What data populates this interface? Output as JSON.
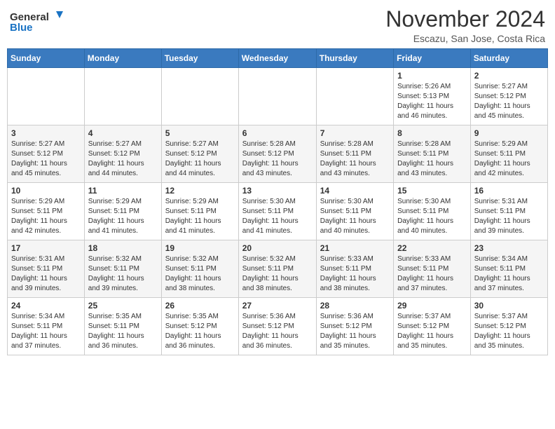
{
  "header": {
    "logo_line1": "General",
    "logo_line2": "Blue",
    "month": "November 2024",
    "location": "Escazu, San Jose, Costa Rica"
  },
  "days_of_week": [
    "Sunday",
    "Monday",
    "Tuesday",
    "Wednesday",
    "Thursday",
    "Friday",
    "Saturday"
  ],
  "weeks": [
    [
      {
        "day": "",
        "info": ""
      },
      {
        "day": "",
        "info": ""
      },
      {
        "day": "",
        "info": ""
      },
      {
        "day": "",
        "info": ""
      },
      {
        "day": "",
        "info": ""
      },
      {
        "day": "1",
        "info": "Sunrise: 5:26 AM\nSunset: 5:13 PM\nDaylight: 11 hours\nand 46 minutes."
      },
      {
        "day": "2",
        "info": "Sunrise: 5:27 AM\nSunset: 5:12 PM\nDaylight: 11 hours\nand 45 minutes."
      }
    ],
    [
      {
        "day": "3",
        "info": "Sunrise: 5:27 AM\nSunset: 5:12 PM\nDaylight: 11 hours\nand 45 minutes."
      },
      {
        "day": "4",
        "info": "Sunrise: 5:27 AM\nSunset: 5:12 PM\nDaylight: 11 hours\nand 44 minutes."
      },
      {
        "day": "5",
        "info": "Sunrise: 5:27 AM\nSunset: 5:12 PM\nDaylight: 11 hours\nand 44 minutes."
      },
      {
        "day": "6",
        "info": "Sunrise: 5:28 AM\nSunset: 5:12 PM\nDaylight: 11 hours\nand 43 minutes."
      },
      {
        "day": "7",
        "info": "Sunrise: 5:28 AM\nSunset: 5:11 PM\nDaylight: 11 hours\nand 43 minutes."
      },
      {
        "day": "8",
        "info": "Sunrise: 5:28 AM\nSunset: 5:11 PM\nDaylight: 11 hours\nand 43 minutes."
      },
      {
        "day": "9",
        "info": "Sunrise: 5:29 AM\nSunset: 5:11 PM\nDaylight: 11 hours\nand 42 minutes."
      }
    ],
    [
      {
        "day": "10",
        "info": "Sunrise: 5:29 AM\nSunset: 5:11 PM\nDaylight: 11 hours\nand 42 minutes."
      },
      {
        "day": "11",
        "info": "Sunrise: 5:29 AM\nSunset: 5:11 PM\nDaylight: 11 hours\nand 41 minutes."
      },
      {
        "day": "12",
        "info": "Sunrise: 5:29 AM\nSunset: 5:11 PM\nDaylight: 11 hours\nand 41 minutes."
      },
      {
        "day": "13",
        "info": "Sunrise: 5:30 AM\nSunset: 5:11 PM\nDaylight: 11 hours\nand 41 minutes."
      },
      {
        "day": "14",
        "info": "Sunrise: 5:30 AM\nSunset: 5:11 PM\nDaylight: 11 hours\nand 40 minutes."
      },
      {
        "day": "15",
        "info": "Sunrise: 5:30 AM\nSunset: 5:11 PM\nDaylight: 11 hours\nand 40 minutes."
      },
      {
        "day": "16",
        "info": "Sunrise: 5:31 AM\nSunset: 5:11 PM\nDaylight: 11 hours\nand 39 minutes."
      }
    ],
    [
      {
        "day": "17",
        "info": "Sunrise: 5:31 AM\nSunset: 5:11 PM\nDaylight: 11 hours\nand 39 minutes."
      },
      {
        "day": "18",
        "info": "Sunrise: 5:32 AM\nSunset: 5:11 PM\nDaylight: 11 hours\nand 39 minutes."
      },
      {
        "day": "19",
        "info": "Sunrise: 5:32 AM\nSunset: 5:11 PM\nDaylight: 11 hours\nand 38 minutes."
      },
      {
        "day": "20",
        "info": "Sunrise: 5:32 AM\nSunset: 5:11 PM\nDaylight: 11 hours\nand 38 minutes."
      },
      {
        "day": "21",
        "info": "Sunrise: 5:33 AM\nSunset: 5:11 PM\nDaylight: 11 hours\nand 38 minutes."
      },
      {
        "day": "22",
        "info": "Sunrise: 5:33 AM\nSunset: 5:11 PM\nDaylight: 11 hours\nand 37 minutes."
      },
      {
        "day": "23",
        "info": "Sunrise: 5:34 AM\nSunset: 5:11 PM\nDaylight: 11 hours\nand 37 minutes."
      }
    ],
    [
      {
        "day": "24",
        "info": "Sunrise: 5:34 AM\nSunset: 5:11 PM\nDaylight: 11 hours\nand 37 minutes."
      },
      {
        "day": "25",
        "info": "Sunrise: 5:35 AM\nSunset: 5:11 PM\nDaylight: 11 hours\nand 36 minutes."
      },
      {
        "day": "26",
        "info": "Sunrise: 5:35 AM\nSunset: 5:12 PM\nDaylight: 11 hours\nand 36 minutes."
      },
      {
        "day": "27",
        "info": "Sunrise: 5:36 AM\nSunset: 5:12 PM\nDaylight: 11 hours\nand 36 minutes."
      },
      {
        "day": "28",
        "info": "Sunrise: 5:36 AM\nSunset: 5:12 PM\nDaylight: 11 hours\nand 35 minutes."
      },
      {
        "day": "29",
        "info": "Sunrise: 5:37 AM\nSunset: 5:12 PM\nDaylight: 11 hours\nand 35 minutes."
      },
      {
        "day": "30",
        "info": "Sunrise: 5:37 AM\nSunset: 5:12 PM\nDaylight: 11 hours\nand 35 minutes."
      }
    ]
  ]
}
